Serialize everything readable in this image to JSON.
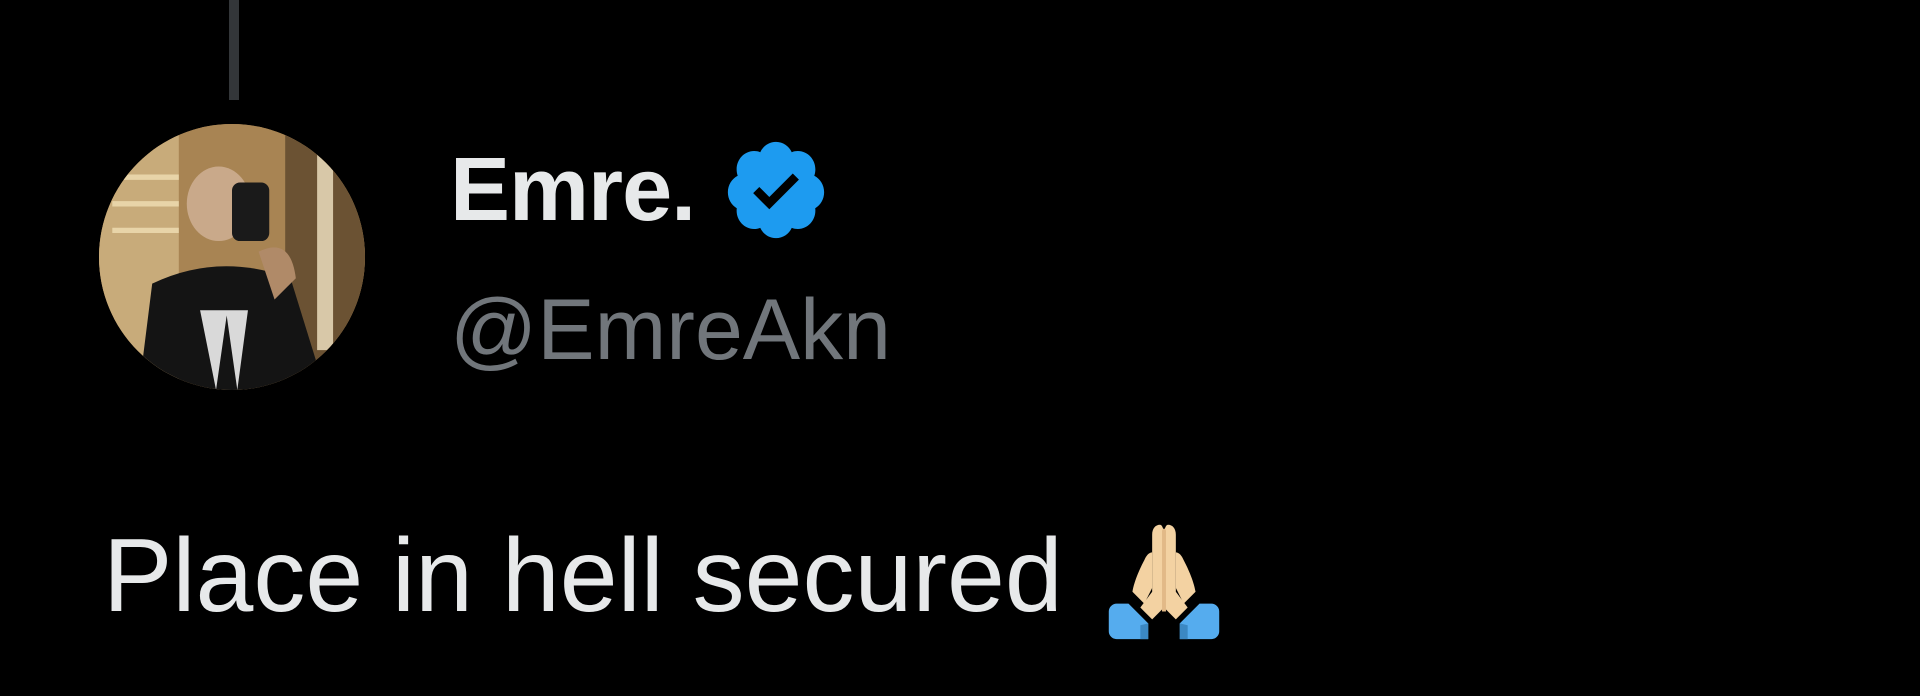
{
  "tweet": {
    "author": {
      "display_name": "Emre.",
      "handle": "@EmreAkn",
      "verified": true,
      "verified_icon": "verified-badge-icon",
      "avatar_icon": "avatar-photo"
    },
    "text": "Place in hell secured",
    "emoji_icon": "folded-hands-emoji"
  },
  "colors": {
    "background": "#000000",
    "primary_text": "#e7e9ea",
    "secondary_text": "#71767b",
    "verified_blue": "#1d9bf0",
    "thread_line": "#333639"
  }
}
